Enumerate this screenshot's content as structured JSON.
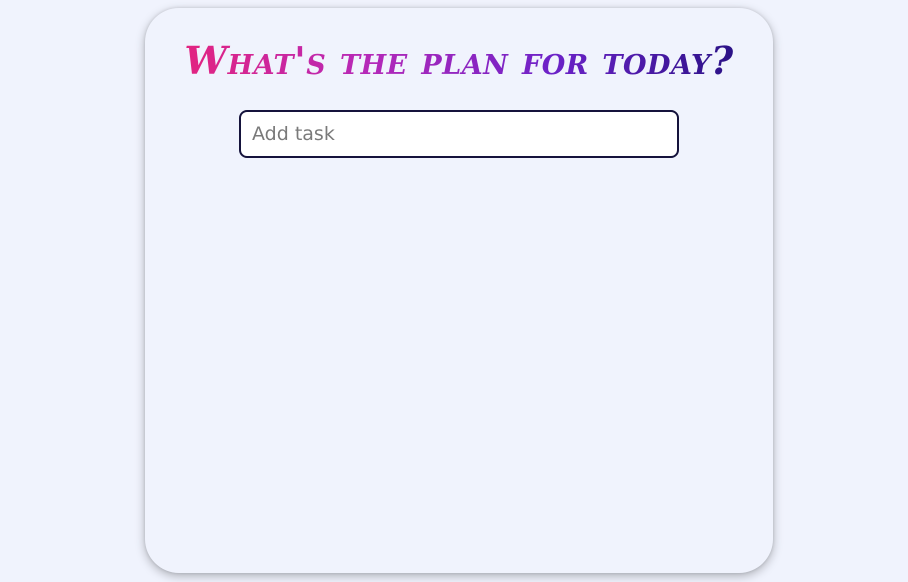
{
  "app": {
    "heading": "What's the plan for today?"
  },
  "task_form": {
    "input_value": "",
    "input_placeholder": "Add task"
  },
  "tasks": [],
  "colors": {
    "background": "#f0f3fd",
    "gradient_start": "#ec2274",
    "gradient_end": "#1d0e78",
    "input_border": "#15133c"
  }
}
